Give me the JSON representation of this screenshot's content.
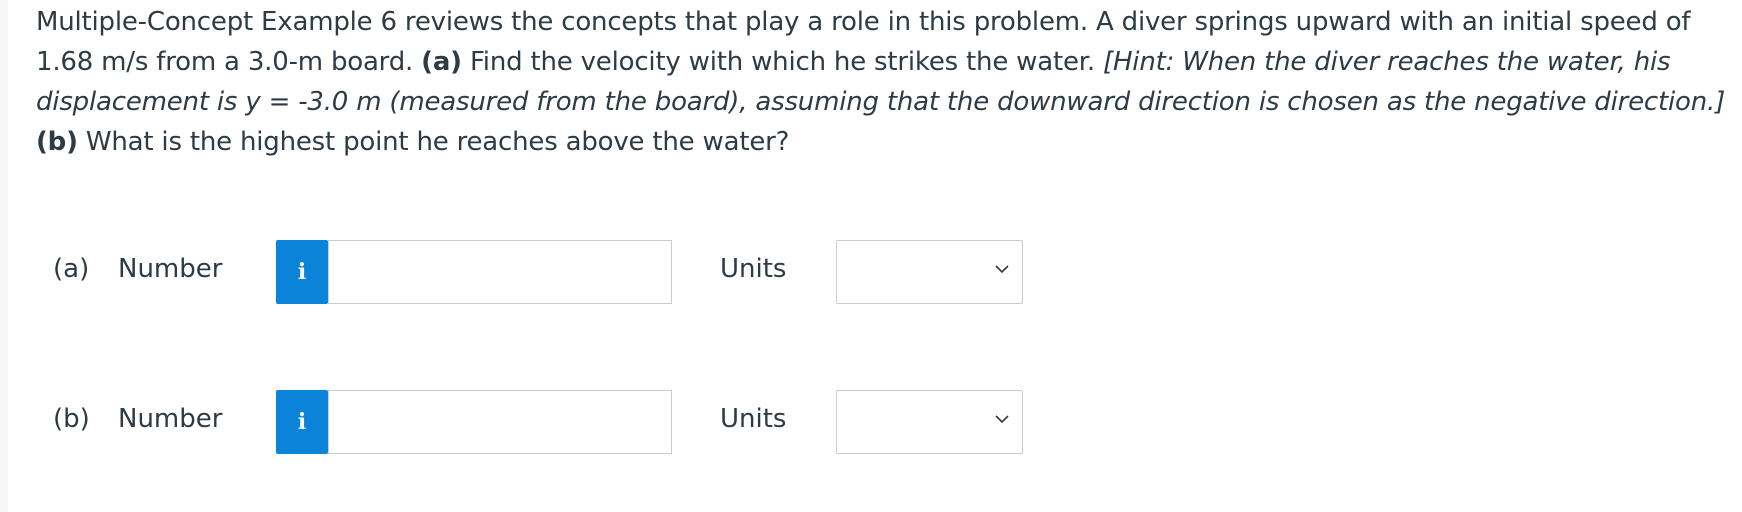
{
  "question": {
    "intro": "Multiple-Concept Example 6 reviews the concepts that play a role in this problem. A diver springs upward with an initial speed of 1.68 m/s from a 3.0-m board. ",
    "part_a_tag": "(a)",
    "part_a_text": " Find the velocity with which he strikes the water. ",
    "hint": "[Hint: When the diver reaches the water, his displacement is y = -3.0 m (measured from the board), assuming that the downward direction is chosen as the negative direction.]",
    "part_b_tag": " (b)",
    "part_b_text": " What is the highest point he reaches above the water?"
  },
  "answers": [
    {
      "part": "(a)",
      "number_label": "Number",
      "info_icon": "i",
      "value": "",
      "units_label": "Units",
      "units_selected": ""
    },
    {
      "part": "(b)",
      "number_label": "Number",
      "info_icon": "i",
      "value": "",
      "units_label": "Units",
      "units_selected": ""
    }
  ],
  "colors": {
    "info_button": "#0b83d8",
    "text": "#2d3b45",
    "border": "#c7cdd1"
  }
}
